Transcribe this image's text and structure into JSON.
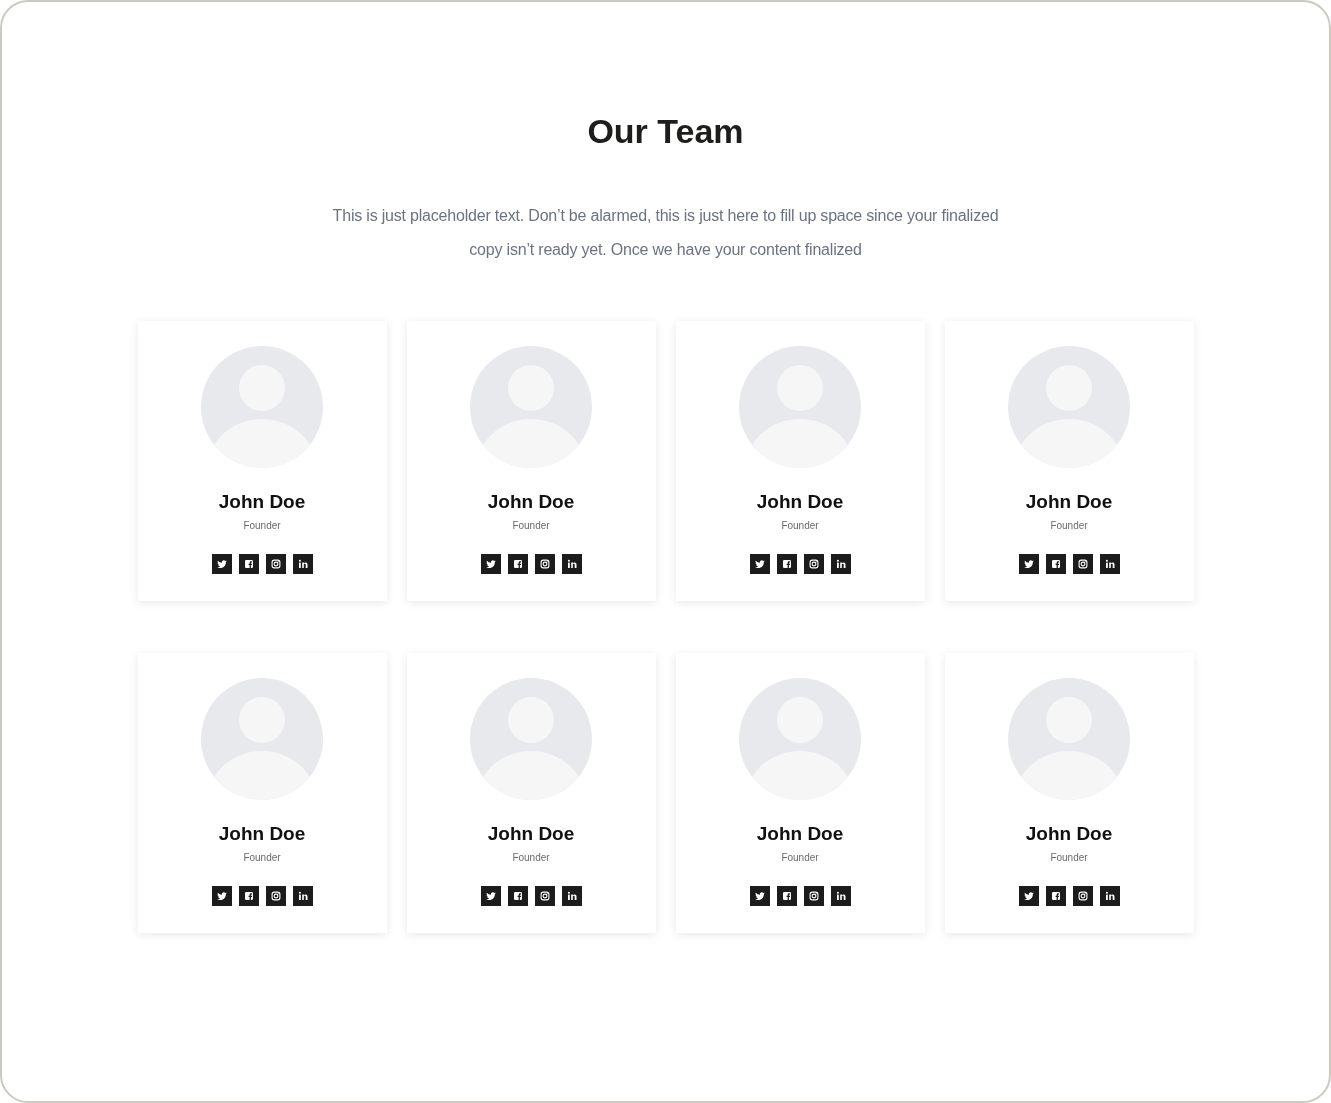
{
  "section": {
    "title": "Our Team",
    "intro": "This is just placeholder text. Don’t be alarmed, this is just here to fill up space since your finalized copy isn’t ready yet. Once we have your content finalized"
  },
  "members": [
    {
      "name": "John Doe",
      "role": "Founder"
    },
    {
      "name": "John Doe",
      "role": "Founder"
    },
    {
      "name": "John Doe",
      "role": "Founder"
    },
    {
      "name": "John Doe",
      "role": "Founder"
    },
    {
      "name": "John Doe",
      "role": "Founder"
    },
    {
      "name": "John Doe",
      "role": "Founder"
    },
    {
      "name": "John Doe",
      "role": "Founder"
    },
    {
      "name": "John Doe",
      "role": "Founder"
    }
  ]
}
